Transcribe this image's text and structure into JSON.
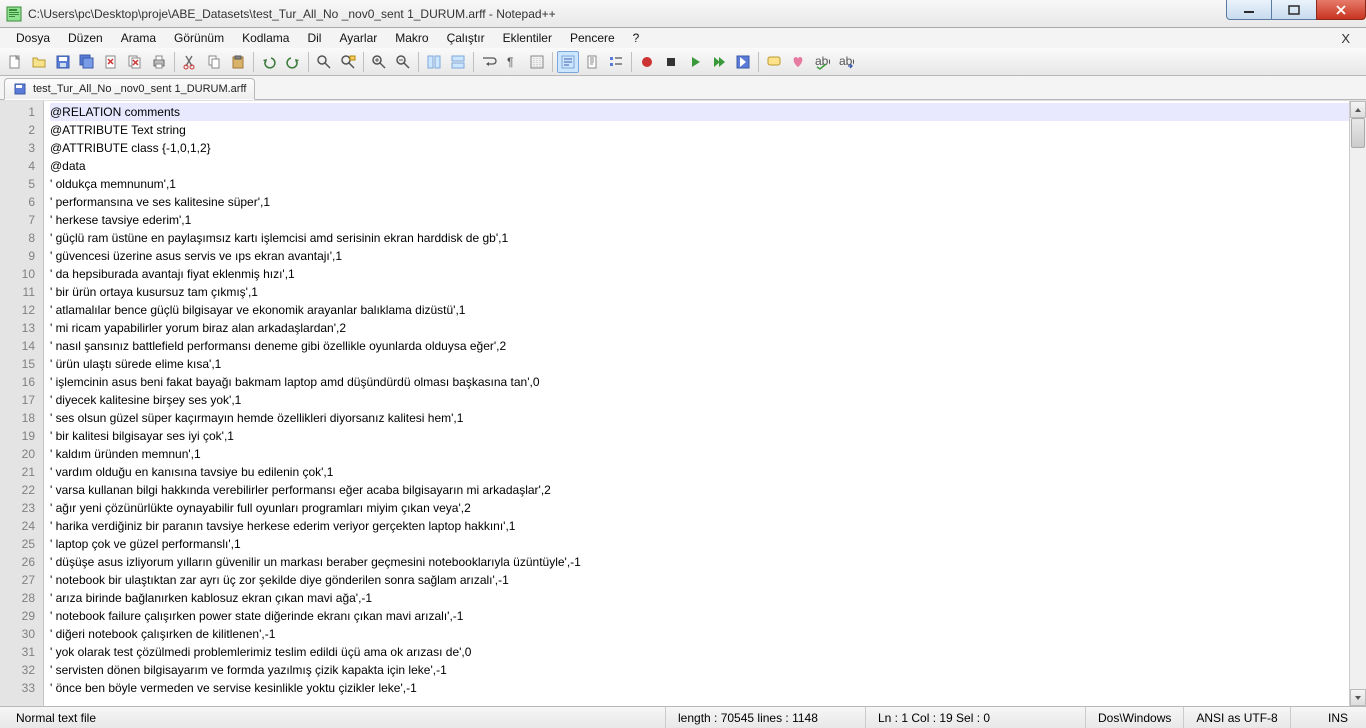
{
  "title": "C:\\Users\\pc\\Desktop\\proje\\ABE_Datasets\\test_Tur_All_No _nov0_sent 1_DURUM.arff - Notepad++",
  "menus": [
    "Dosya",
    "Düzen",
    "Arama",
    "Görünüm",
    "Kodlama",
    "Dil",
    "Ayarlar",
    "Makro",
    "Çalıştır",
    "Eklentiler",
    "Pencere",
    "?"
  ],
  "tab": {
    "label": "test_Tur_All_No _nov0_sent 1_DURUM.arff"
  },
  "lines": [
    "@RELATION comments",
    "@ATTRIBUTE Text string",
    "@ATTRIBUTE class {-1,0,1,2}",
    "@data",
    "' oldukça memnunum',1",
    "' performansına ve ses kalitesine süper',1",
    "' herkese tavsiye ederim',1",
    "' güçlü ram üstüne en paylaşımsız kartı işlemcisi amd serisinin ekran harddisk de gb',1",
    "' güvencesi üzerine asus servis ve ıps ekran avantajı',1",
    "' da hepsiburada avantajı fiyat eklenmiş hızı',1",
    "' bir ürün ortaya kusursuz tam çıkmış',1",
    "' atlamalılar bence güçlü bilgisayar ve ekonomik arayanlar balıklama dizüstü',1",
    "' mi ricam yapabilirler yorum biraz alan arkadaşlardan',2",
    "' nasıl şansınız battlefield performansı deneme gibi özellikle oyunlarda olduysa eğer',2",
    "' ürün ulaştı sürede elime kısa',1",
    "' işlemcinin asus beni fakat bayağı bakmam laptop amd düşündürdü olması başkasına tan',0",
    "' diyecek kalitesine birşey ses yok',1",
    "' ses olsun güzel süper kaçırmayın hemde özellikleri diyorsanız kalitesi hem',1",
    "' bir kalitesi bilgisayar ses iyi çok',1",
    "' kaldım üründen memnun',1",
    "' vardım olduğu en kanısına tavsiye bu edilenin çok',1",
    "' varsa kullanan bilgi hakkında verebilirler performansı eğer acaba bilgisayarın mi arkadaşlar',2",
    "' ağır yeni çözünürlükte oynayabilir full oyunları programları miyim çıkan veya',2",
    "' harika verdiğiniz bir paranın tavsiye herkese ederim veriyor gerçekten laptop hakkını',1",
    "' laptop çok ve güzel performanslı',1",
    "' düşüşe asus izliyorum yılların güvenilir un markası beraber geçmesini notebooklarıyla üzüntüyle',-1",
    "' notebook bir ulaştıktan zar ayrı üç zor şekilde diye gönderilen sonra sağlam arızalı',-1",
    "' arıza birinde bağlanırken kablosuz ekran çıkan mavi ağa',-1",
    "' notebook failure çalışırken power state diğerinde ekranı çıkan mavi arızalı',-1",
    "' diğeri notebook çalışırken de kilitlenen',-1",
    "' yok olarak test çözülmedi problemlerimiz teslim edildi üçü ama ok arızası de',0",
    "' servisten dönen bilgisayarım ve formda yazılmış çizik kapakta için leke',-1",
    "' önce ben böyle vermeden ve servise kesinlikle yoktu çizikler leke',-1"
  ],
  "status": {
    "mode": "Normal text file",
    "length": "length : 70545    lines : 1148",
    "pos": "Ln : 1    Col : 19    Sel : 0",
    "eol": "Dos\\Windows",
    "enc": "ANSI as UTF-8",
    "ins": "INS"
  }
}
